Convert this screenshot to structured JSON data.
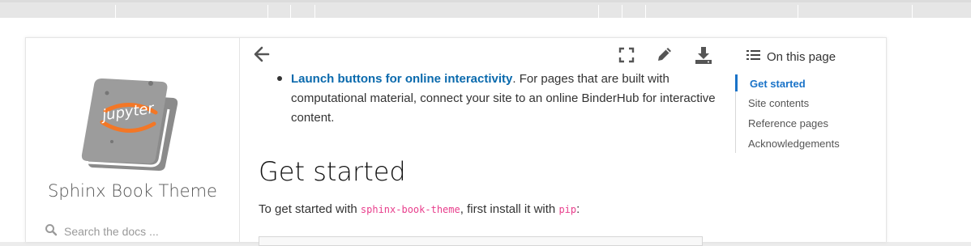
{
  "colors": {
    "link": "#0a6aad",
    "toc_active": "#1a73c8",
    "code_text": "#e83e8c"
  },
  "sidebar": {
    "logo_text": "jupyter",
    "site_title": "Sphinx Book Theme",
    "search_placeholder": "Search the docs ..."
  },
  "toolbar": {
    "back_icon": "arrow-left-icon",
    "fullscreen_icon": "fullscreen-icon",
    "edit_icon": "pencil-icon",
    "download_icon": "download-icon"
  },
  "content": {
    "bullet": {
      "link_text": "Launch buttons for online interactivity",
      "rest_text": ". For pages that are built with computational material, connect your site to an online BinderHub for interactive content."
    },
    "heading": "Get started",
    "intro": {
      "before": "To get started with ",
      "code1": "sphinx-book-theme",
      "middle": ", first install it with ",
      "code2": "pip",
      "after": ":"
    }
  },
  "toc": {
    "header": "On this page",
    "items": [
      {
        "label": "Get started",
        "active": true
      },
      {
        "label": "Site contents",
        "active": false
      },
      {
        "label": "Reference pages",
        "active": false
      },
      {
        "label": "Acknowledgements",
        "active": false
      }
    ]
  }
}
